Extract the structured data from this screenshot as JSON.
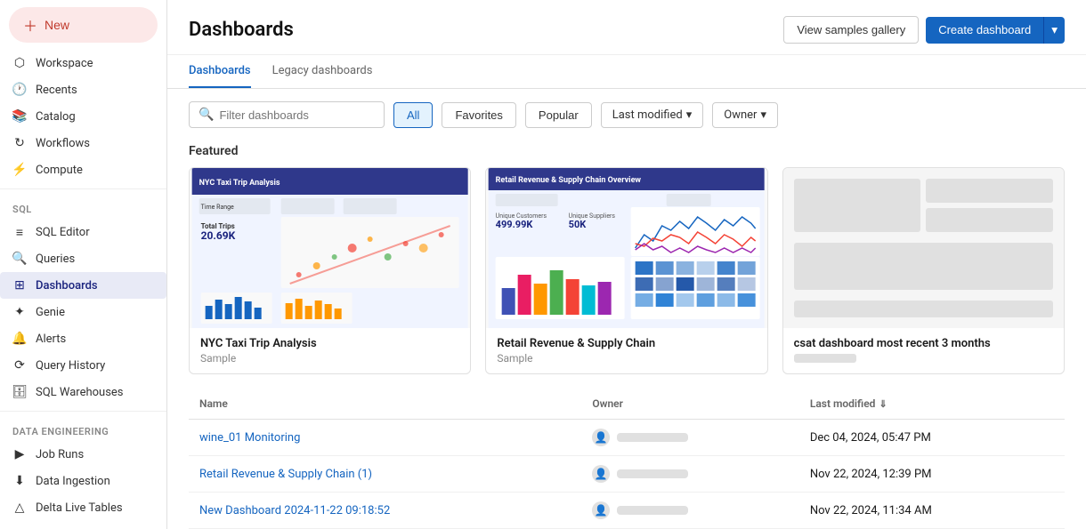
{
  "sidebar": {
    "new_button": "New",
    "workspace_label": "Workspace",
    "recents_label": "Recents",
    "catalog_label": "Catalog",
    "workflows_label": "Workflows",
    "compute_label": "Compute",
    "sql_section": "SQL",
    "sql_editor_label": "SQL Editor",
    "queries_label": "Queries",
    "dashboards_label": "Dashboards",
    "genie_label": "Genie",
    "alerts_label": "Alerts",
    "query_history_label": "Query History",
    "sql_warehouses_label": "SQL Warehouses",
    "data_engineering_section": "Data Engineering",
    "job_runs_label": "Job Runs",
    "data_ingestion_label": "Data Ingestion",
    "delta_live_tables_label": "Delta Live Tables"
  },
  "header": {
    "title": "Dashboards",
    "view_samples_gallery": "View samples gallery",
    "create_dashboard": "Create dashboard"
  },
  "tabs": [
    {
      "label": "Dashboards",
      "active": true
    },
    {
      "label": "Legacy dashboards",
      "active": false
    }
  ],
  "filters": {
    "search_placeholder": "Filter dashboards",
    "all_label": "All",
    "favorites_label": "Favorites",
    "popular_label": "Popular",
    "last_modified_label": "Last modified",
    "owner_label": "Owner"
  },
  "featured_section": "Featured",
  "featured_cards": [
    {
      "title": "NYC Taxi Trip Analysis",
      "subtitle": "Sample",
      "thumb_type": "nyc"
    },
    {
      "title": "Retail Revenue & Supply Chain",
      "subtitle": "Sample",
      "thumb_type": "retail"
    },
    {
      "title": "csat dashboard most recent 3 months",
      "subtitle": "",
      "thumb_type": "csat"
    }
  ],
  "table": {
    "col_name": "Name",
    "col_owner": "Owner",
    "col_last_modified": "Last modified",
    "rows": [
      {
        "name": "wine_01 Monitoring",
        "owner_placeholder": true,
        "last_modified": "Dec 04, 2024, 05:47 PM"
      },
      {
        "name": "Retail Revenue & Supply Chain (1)",
        "owner_placeholder": true,
        "last_modified": "Nov 22, 2024, 12:39 PM"
      },
      {
        "name": "New Dashboard 2024-11-22 09:18:52",
        "owner_placeholder": true,
        "last_modified": "Nov 22, 2024, 11:34 AM"
      }
    ]
  }
}
